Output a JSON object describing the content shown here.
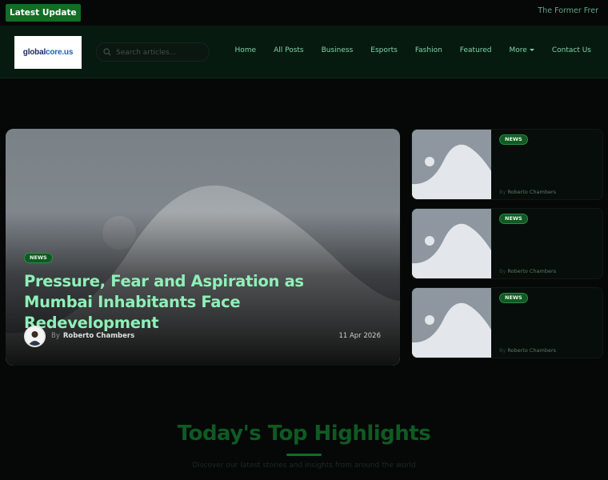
{
  "topbar": {
    "latest_label": "Latest Update",
    "ticker_text": "The Former Frer"
  },
  "header": {
    "logo_text_main": "global",
    "logo_text_accent": "core.us",
    "search_placeholder": "Search articles...",
    "nav": [
      {
        "label": "Home"
      },
      {
        "label": "All Posts"
      },
      {
        "label": "Business"
      },
      {
        "label": "Esports"
      },
      {
        "label": "Fashion"
      },
      {
        "label": "Featured"
      },
      {
        "label": "More"
      },
      {
        "label": "Contact Us"
      }
    ]
  },
  "hero": {
    "badge": "NEWS",
    "title": "Pressure, Fear and Aspiration as Mumbai Inhabitants Face Redevelopment",
    "by": "By",
    "author": "Roberto Chambers",
    "date": "11 Apr 2026"
  },
  "side_cards": [
    {
      "badge": "NEWS",
      "by": "By",
      "author": "Roberto Chambers"
    },
    {
      "badge": "NEWS",
      "by": "By",
      "author": "Roberto Chambers"
    },
    {
      "badge": "NEWS",
      "by": "By",
      "author": "Roberto Chambers"
    }
  ],
  "section": {
    "title": "Today's Top Highlights",
    "subtitle": "Discover our latest stories and insights from around the world"
  },
  "colors": {
    "accent": "#136d25",
    "headline": "#8ff0b8",
    "nav": "#7fd3a9",
    "background": "#050807"
  }
}
